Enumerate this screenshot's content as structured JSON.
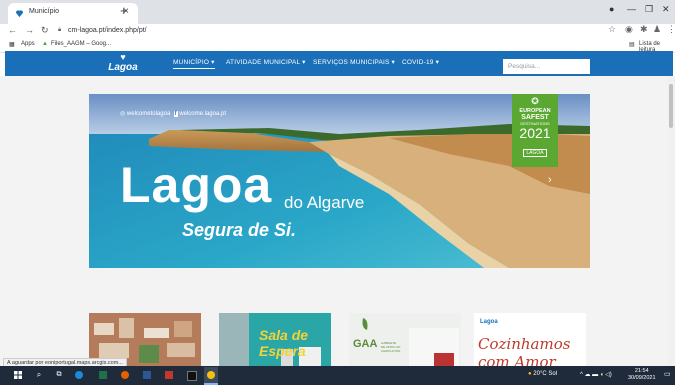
{
  "browser": {
    "tab_title": "Município",
    "url": "cm-lagoa.pt/index.php/pt/",
    "bookmarks": [
      "Apps",
      "Files_AAGM – Goog..."
    ],
    "reading_list": "Lista de leitura"
  },
  "site": {
    "logo_text": "Lagoa",
    "nav": [
      "MUNICÍPIO",
      "ATIVIDADE MUNICIPAL",
      "SERVIÇOS MUNICIPAIS",
      "COVID-19"
    ],
    "search_placeholder": "Pesquisa..."
  },
  "hero": {
    "social_instagram": "welcometolagoa",
    "social_web": "welcome.lagoa.pt",
    "title": "Lagoa",
    "subtitle": "do Algarve",
    "slogan": "Segura de Si.",
    "badge": {
      "line1": "EUROPEAN",
      "line2": "SAFEST",
      "line3": "DESTINATIONS",
      "year": "2021",
      "tag": "LAGOA"
    }
  },
  "cards": {
    "card2": "Sala de Espera",
    "card3": "GAA",
    "card3_small": "GABINETE DE APOIO AO AGRICULTOR",
    "card4_logo": "Lagoa",
    "card4_text": "Cozinhamos com Amor"
  },
  "status_text": "A aguardar por eoniportugal.maps.arcgis.com...",
  "taskbar": {
    "weather": "20°C Sol",
    "time": "21:54",
    "date": "30/09/2021"
  },
  "colors": {
    "nav_blue": "#1a6fb8",
    "badge_green": "#5aa832",
    "taskbar": "#1f2b3a"
  }
}
